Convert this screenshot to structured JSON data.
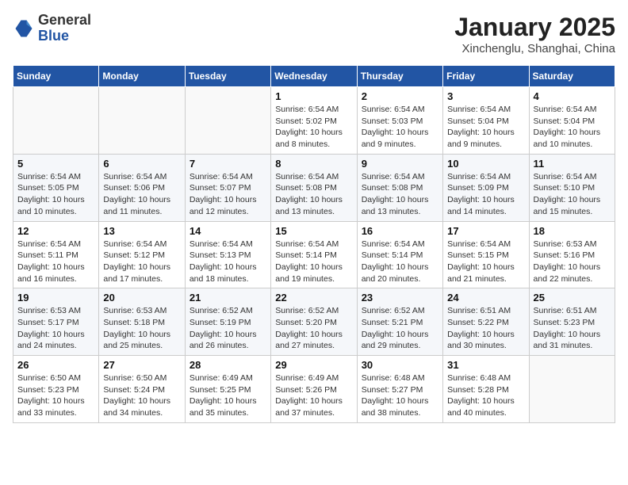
{
  "header": {
    "logo_general": "General",
    "logo_blue": "Blue",
    "title": "January 2025",
    "subtitle": "Xinchenglu, Shanghai, China"
  },
  "weekdays": [
    "Sunday",
    "Monday",
    "Tuesday",
    "Wednesday",
    "Thursday",
    "Friday",
    "Saturday"
  ],
  "weeks": [
    [
      {
        "day": "",
        "info": ""
      },
      {
        "day": "",
        "info": ""
      },
      {
        "day": "",
        "info": ""
      },
      {
        "day": "1",
        "info": "Sunrise: 6:54 AM\nSunset: 5:02 PM\nDaylight: 10 hours\nand 8 minutes."
      },
      {
        "day": "2",
        "info": "Sunrise: 6:54 AM\nSunset: 5:03 PM\nDaylight: 10 hours\nand 9 minutes."
      },
      {
        "day": "3",
        "info": "Sunrise: 6:54 AM\nSunset: 5:04 PM\nDaylight: 10 hours\nand 9 minutes."
      },
      {
        "day": "4",
        "info": "Sunrise: 6:54 AM\nSunset: 5:04 PM\nDaylight: 10 hours\nand 10 minutes."
      }
    ],
    [
      {
        "day": "5",
        "info": "Sunrise: 6:54 AM\nSunset: 5:05 PM\nDaylight: 10 hours\nand 10 minutes."
      },
      {
        "day": "6",
        "info": "Sunrise: 6:54 AM\nSunset: 5:06 PM\nDaylight: 10 hours\nand 11 minutes."
      },
      {
        "day": "7",
        "info": "Sunrise: 6:54 AM\nSunset: 5:07 PM\nDaylight: 10 hours\nand 12 minutes."
      },
      {
        "day": "8",
        "info": "Sunrise: 6:54 AM\nSunset: 5:08 PM\nDaylight: 10 hours\nand 13 minutes."
      },
      {
        "day": "9",
        "info": "Sunrise: 6:54 AM\nSunset: 5:08 PM\nDaylight: 10 hours\nand 13 minutes."
      },
      {
        "day": "10",
        "info": "Sunrise: 6:54 AM\nSunset: 5:09 PM\nDaylight: 10 hours\nand 14 minutes."
      },
      {
        "day": "11",
        "info": "Sunrise: 6:54 AM\nSunset: 5:10 PM\nDaylight: 10 hours\nand 15 minutes."
      }
    ],
    [
      {
        "day": "12",
        "info": "Sunrise: 6:54 AM\nSunset: 5:11 PM\nDaylight: 10 hours\nand 16 minutes."
      },
      {
        "day": "13",
        "info": "Sunrise: 6:54 AM\nSunset: 5:12 PM\nDaylight: 10 hours\nand 17 minutes."
      },
      {
        "day": "14",
        "info": "Sunrise: 6:54 AM\nSunset: 5:13 PM\nDaylight: 10 hours\nand 18 minutes."
      },
      {
        "day": "15",
        "info": "Sunrise: 6:54 AM\nSunset: 5:14 PM\nDaylight: 10 hours\nand 19 minutes."
      },
      {
        "day": "16",
        "info": "Sunrise: 6:54 AM\nSunset: 5:14 PM\nDaylight: 10 hours\nand 20 minutes."
      },
      {
        "day": "17",
        "info": "Sunrise: 6:54 AM\nSunset: 5:15 PM\nDaylight: 10 hours\nand 21 minutes."
      },
      {
        "day": "18",
        "info": "Sunrise: 6:53 AM\nSunset: 5:16 PM\nDaylight: 10 hours\nand 22 minutes."
      }
    ],
    [
      {
        "day": "19",
        "info": "Sunrise: 6:53 AM\nSunset: 5:17 PM\nDaylight: 10 hours\nand 24 minutes."
      },
      {
        "day": "20",
        "info": "Sunrise: 6:53 AM\nSunset: 5:18 PM\nDaylight: 10 hours\nand 25 minutes."
      },
      {
        "day": "21",
        "info": "Sunrise: 6:52 AM\nSunset: 5:19 PM\nDaylight: 10 hours\nand 26 minutes."
      },
      {
        "day": "22",
        "info": "Sunrise: 6:52 AM\nSunset: 5:20 PM\nDaylight: 10 hours\nand 27 minutes."
      },
      {
        "day": "23",
        "info": "Sunrise: 6:52 AM\nSunset: 5:21 PM\nDaylight: 10 hours\nand 29 minutes."
      },
      {
        "day": "24",
        "info": "Sunrise: 6:51 AM\nSunset: 5:22 PM\nDaylight: 10 hours\nand 30 minutes."
      },
      {
        "day": "25",
        "info": "Sunrise: 6:51 AM\nSunset: 5:23 PM\nDaylight: 10 hours\nand 31 minutes."
      }
    ],
    [
      {
        "day": "26",
        "info": "Sunrise: 6:50 AM\nSunset: 5:23 PM\nDaylight: 10 hours\nand 33 minutes."
      },
      {
        "day": "27",
        "info": "Sunrise: 6:50 AM\nSunset: 5:24 PM\nDaylight: 10 hours\nand 34 minutes."
      },
      {
        "day": "28",
        "info": "Sunrise: 6:49 AM\nSunset: 5:25 PM\nDaylight: 10 hours\nand 35 minutes."
      },
      {
        "day": "29",
        "info": "Sunrise: 6:49 AM\nSunset: 5:26 PM\nDaylight: 10 hours\nand 37 minutes."
      },
      {
        "day": "30",
        "info": "Sunrise: 6:48 AM\nSunset: 5:27 PM\nDaylight: 10 hours\nand 38 minutes."
      },
      {
        "day": "31",
        "info": "Sunrise: 6:48 AM\nSunset: 5:28 PM\nDaylight: 10 hours\nand 40 minutes."
      },
      {
        "day": "",
        "info": ""
      }
    ]
  ]
}
